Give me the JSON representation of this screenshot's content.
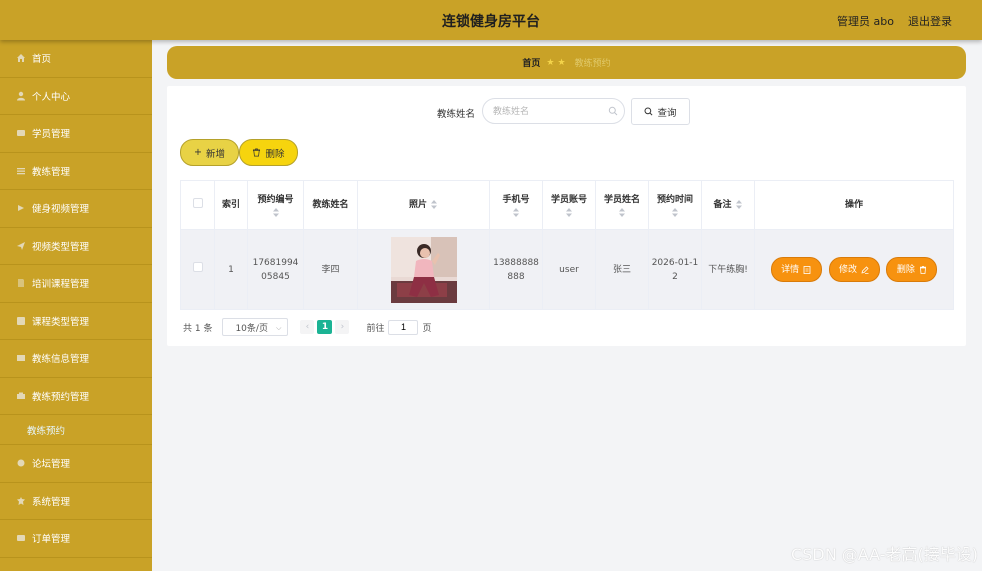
{
  "header": {
    "title": "连锁健身房平台",
    "user": "管理员 abo",
    "logout": "退出登录"
  },
  "sidebar": {
    "items": [
      {
        "label": "首页",
        "icon": "home-icon"
      },
      {
        "label": "个人中心",
        "icon": "user-icon"
      },
      {
        "label": "学员管理",
        "icon": "users-icon"
      },
      {
        "label": "教练管理",
        "icon": "list-icon"
      },
      {
        "label": "健身视频管理",
        "icon": "video-icon"
      },
      {
        "label": "视频类型管理",
        "icon": "send-icon"
      },
      {
        "label": "培训课程管理",
        "icon": "course-icon"
      },
      {
        "label": "课程类型管理",
        "icon": "type-icon"
      },
      {
        "label": "教练信息管理",
        "icon": "info-icon"
      },
      {
        "label": "教练预约管理",
        "icon": "booking-icon"
      }
    ],
    "sub_item": "教练预约",
    "items2": [
      {
        "label": "论坛管理",
        "icon": "forum-icon"
      },
      {
        "label": "系统管理",
        "icon": "system-icon"
      },
      {
        "label": "订单管理",
        "icon": "order-icon"
      }
    ]
  },
  "breadcrumb": {
    "home": "首页",
    "current": "教练预约"
  },
  "search": {
    "label": "教练姓名",
    "placeholder": "教练姓名",
    "query_button": "查询"
  },
  "actions": {
    "add": "新增",
    "delete": "删除"
  },
  "table": {
    "headers": {
      "index": "索引",
      "booking_no": "预约编号",
      "coach_name": "教练姓名",
      "photo": "照片",
      "phone": "手机号",
      "student_account": "学员账号",
      "student_name": "学员姓名",
      "booking_time": "预约时间",
      "remark": "备注",
      "ops": "操作"
    },
    "rows": [
      {
        "index": "1",
        "booking_no": "1768199405845",
        "coach_name": "李四",
        "phone": "13888888888",
        "student_account": "user",
        "student_name": "张三",
        "booking_time": "2026-01-12",
        "remark": "下午练胸!",
        "btn_detail": "详情",
        "btn_edit": "修改",
        "btn_delete": "删除"
      }
    ]
  },
  "pagination": {
    "total": "共 1 条",
    "page_size": "10条/页",
    "current_page": "1",
    "goto": "前往",
    "page_suffix": "页",
    "jump_value": "1"
  },
  "watermark": "CSDN @AA-老高(接毕设)",
  "colors": {
    "sidebar": "#c9a227",
    "accent_orange": "#f7920f",
    "page_active": "#1bb394",
    "add_btn": "#e8d245",
    "delete_btn": "#f6d40e"
  }
}
